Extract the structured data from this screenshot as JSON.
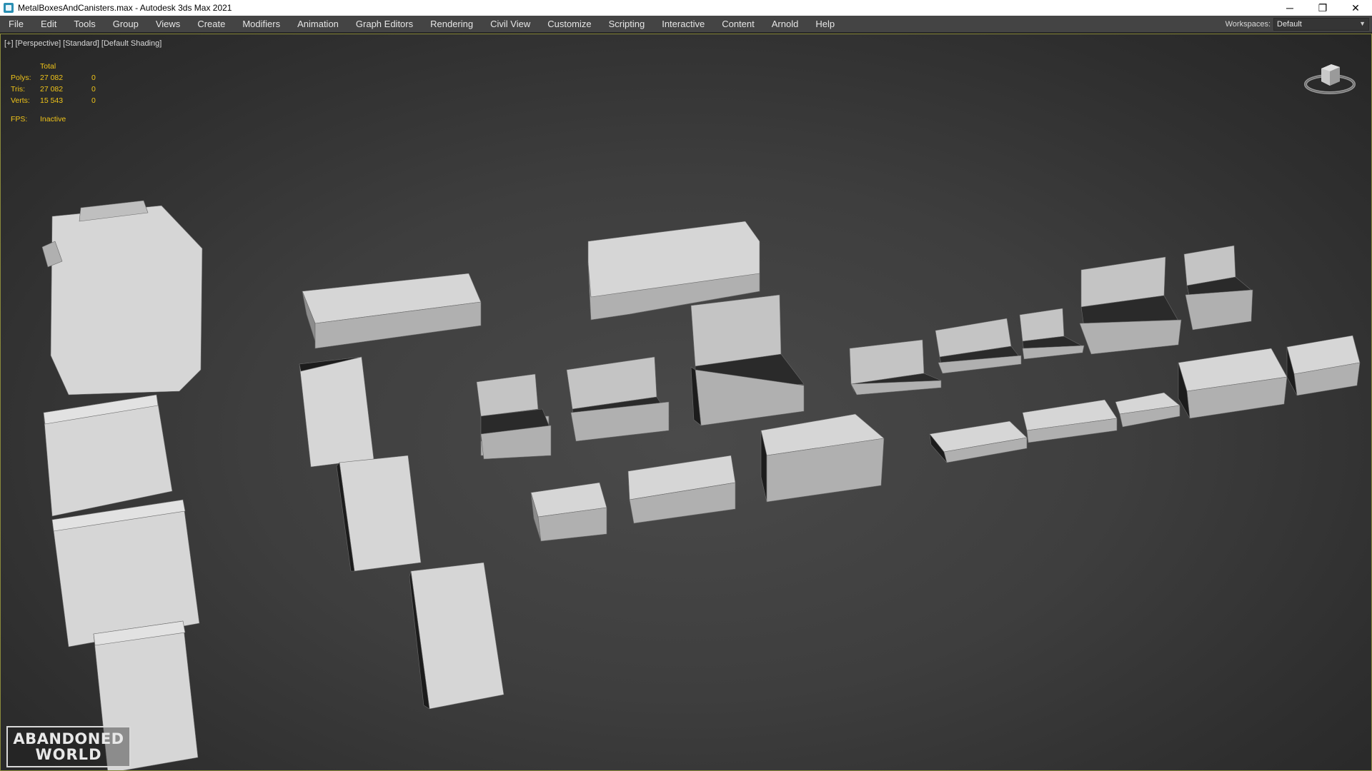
{
  "window": {
    "title": "MetalBoxesAndCanisters.max - Autodesk 3ds Max 2021",
    "app_icon": "3ds-max-icon",
    "controls": {
      "minimize": "─",
      "restore": "❐",
      "close": "✕"
    }
  },
  "menu": {
    "items": [
      "File",
      "Edit",
      "Tools",
      "Group",
      "Views",
      "Create",
      "Modifiers",
      "Animation",
      "Graph Editors",
      "Rendering",
      "Civil View",
      "Customize",
      "Scripting",
      "Interactive",
      "Content",
      "Arnold",
      "Help"
    ]
  },
  "workspaces": {
    "label": "Workspaces:",
    "value": "Default"
  },
  "viewport": {
    "labels": [
      "[+]",
      "[Perspective]",
      "[Standard]",
      "[Default Shading]"
    ],
    "stats": {
      "header": "Total",
      "rows": [
        {
          "label": "Polys:",
          "total": "27 082",
          "selected": "0"
        },
        {
          "label": "Tris:",
          "total": "27 082",
          "selected": "0"
        },
        {
          "label": "Verts:",
          "total": "15 543",
          "selected": "0"
        }
      ],
      "fps_label": "FPS:",
      "fps_value": "Inactive"
    },
    "viewcube_icon": "viewcube-icon"
  },
  "watermark": {
    "line1": "ABANDONED",
    "line2": "WORLD"
  },
  "colors": {
    "viewport_border": "#8a8a3c",
    "stats_text": "#f0c419",
    "menubar_bg": "#444444",
    "model_light": "#d4d4d4",
    "model_mid": "#a8a8a8",
    "model_dark": "#1e1e1e"
  }
}
